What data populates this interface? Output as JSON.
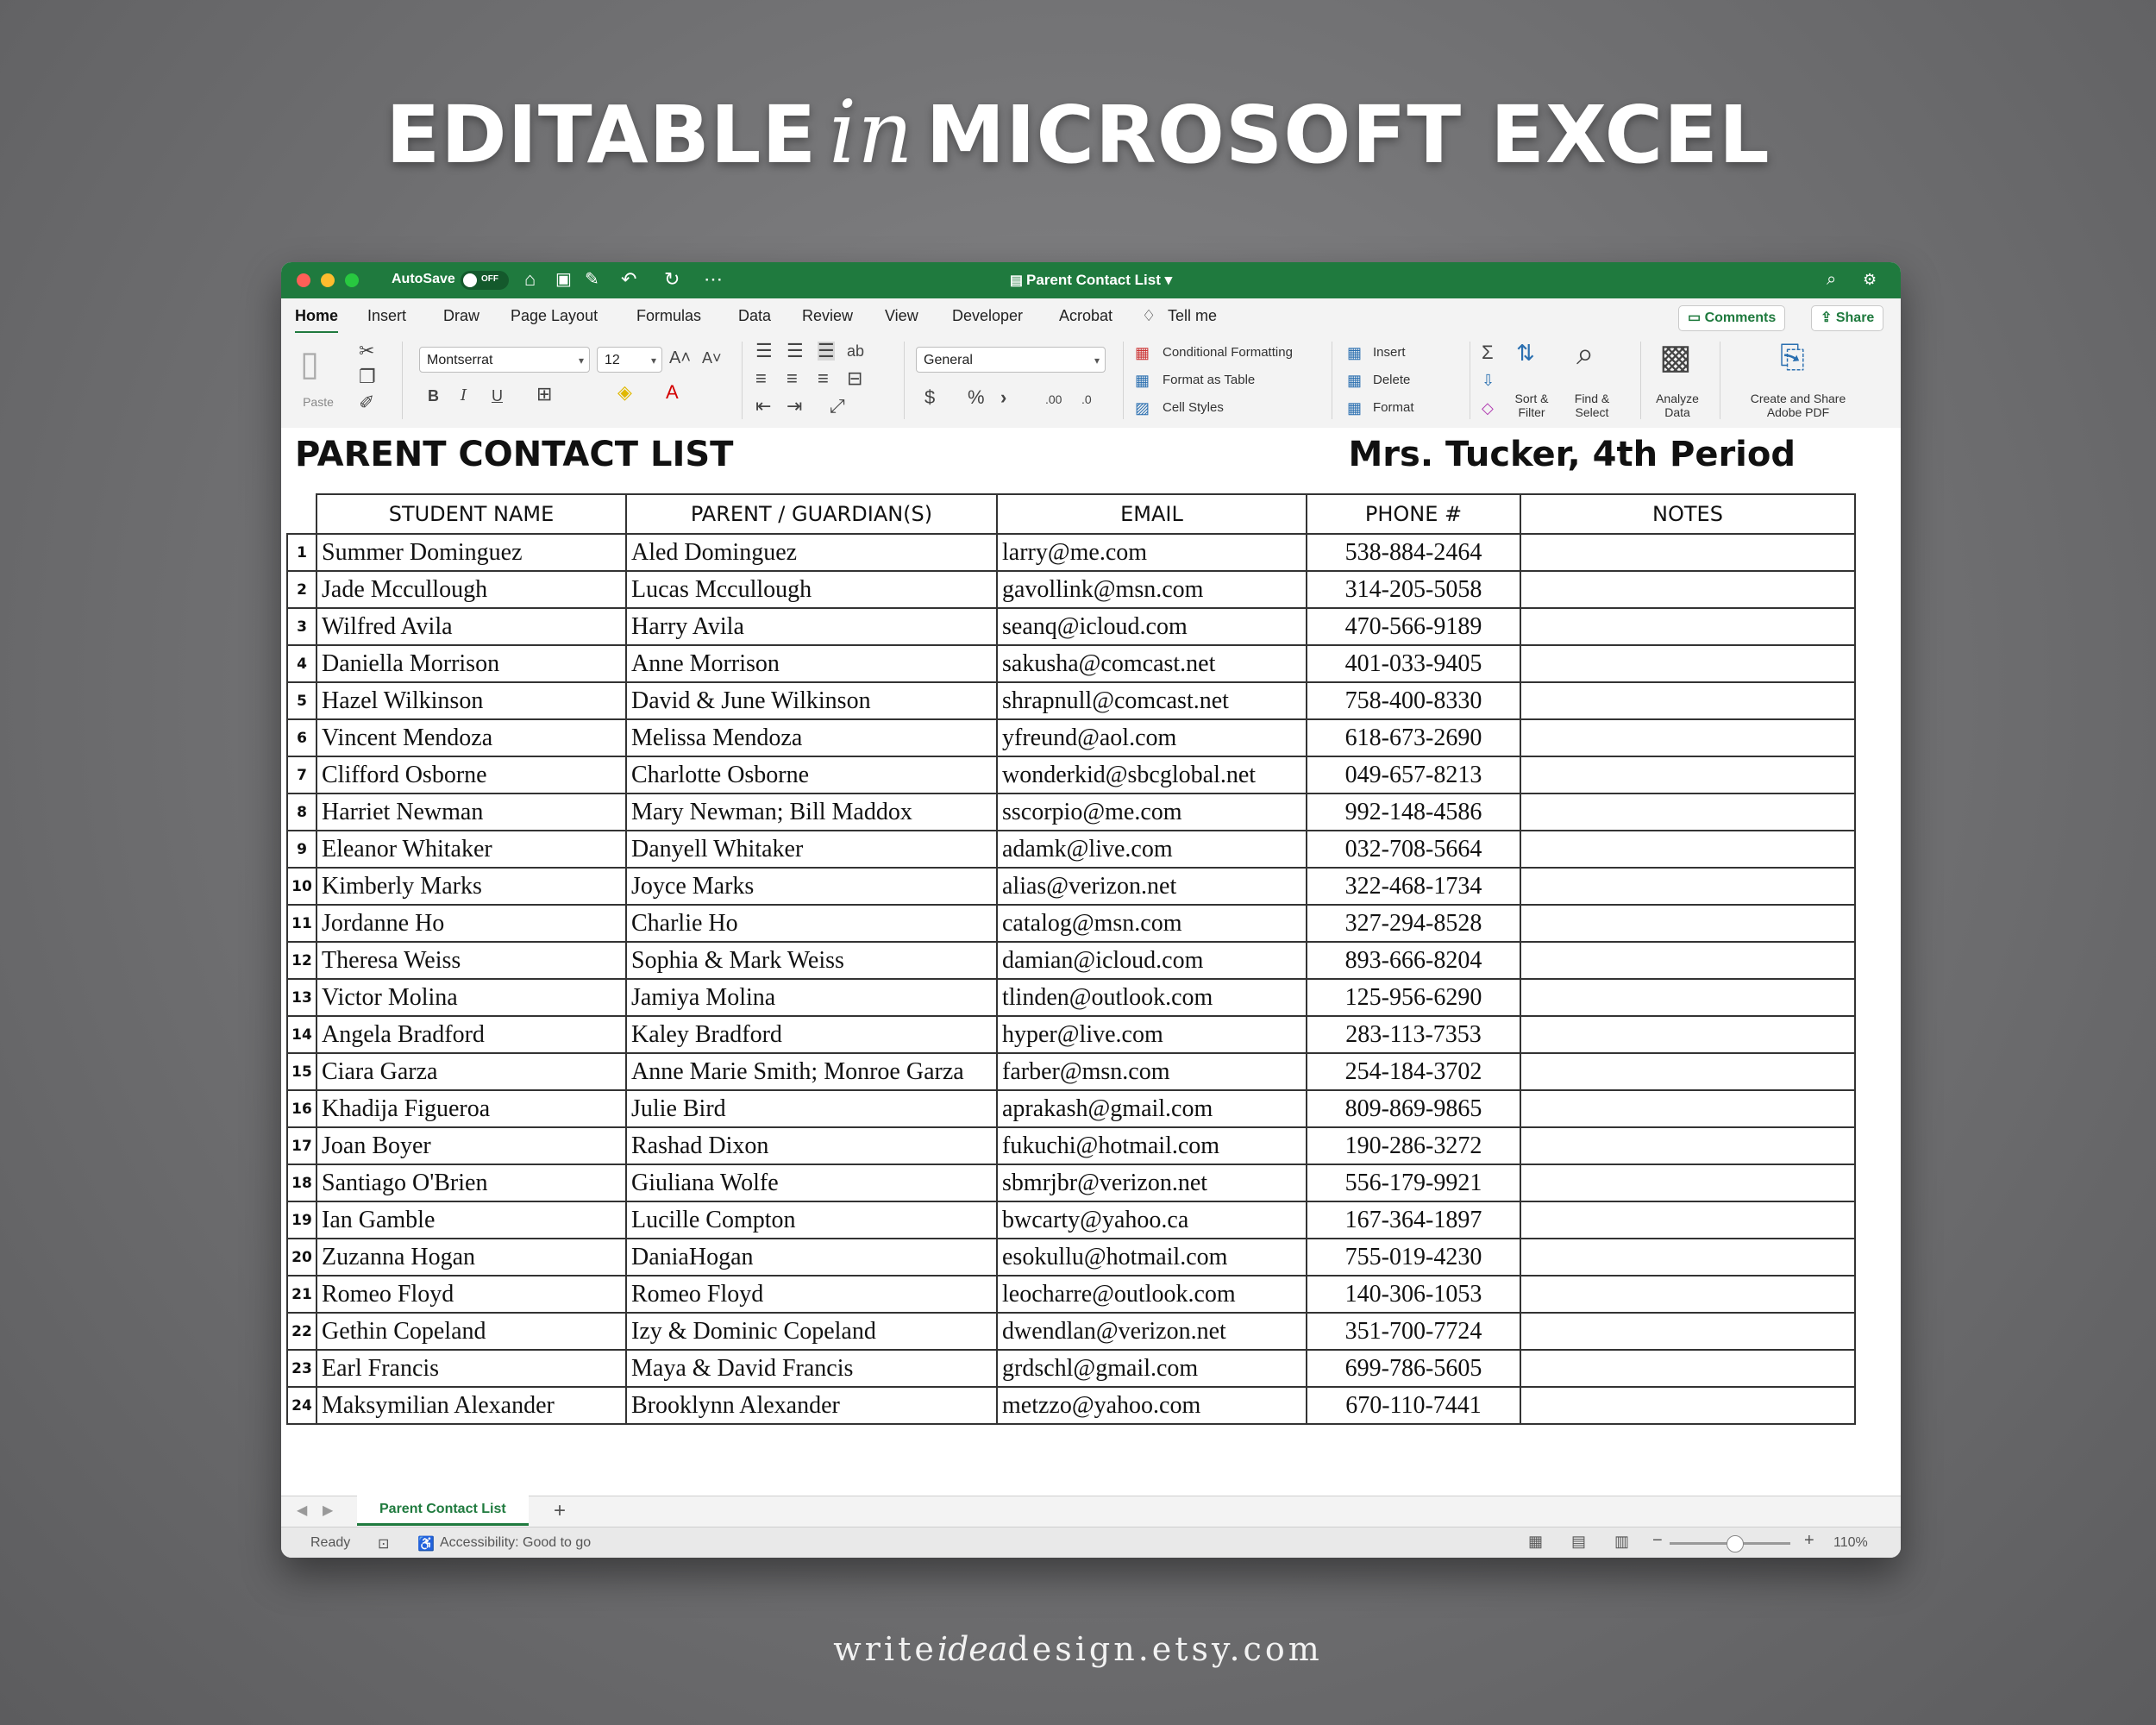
{
  "promo": {
    "headline_left": "EDITABLE",
    "headline_script": "in",
    "headline_right": "MICROSOFT EXCEL",
    "credit_a": "write",
    "credit_b": "idea",
    "credit_c": "design.etsy.com"
  },
  "titlebar": {
    "autosave_label": "AutoSave",
    "autosave_state": "OFF",
    "document_title": "Parent Contact List"
  },
  "ribbon_tabs": [
    "Home",
    "Insert",
    "Draw",
    "Page Layout",
    "Formulas",
    "Data",
    "Review",
    "View",
    "Developer",
    "Acrobat"
  ],
  "tell_me": "Tell me",
  "comments_label": "Comments",
  "share_label": "Share",
  "ribbon": {
    "paste_label": "Paste",
    "font_name": "Montserrat",
    "font_size": "12",
    "number_format": "General",
    "conditional_formatting": "Conditional Formatting",
    "format_as_table": "Format as Table",
    "cell_styles": "Cell Styles",
    "insert": "Insert",
    "delete": "Delete",
    "format": "Format",
    "sort_filter_1": "Sort &",
    "sort_filter_2": "Filter",
    "find_select_1": "Find &",
    "find_select_2": "Select",
    "analyze_1": "Analyze",
    "analyze_2": "Data",
    "pdf_1": "Create and Share",
    "pdf_2": "Adobe PDF"
  },
  "sheet": {
    "title": "PARENT CONTACT LIST",
    "subtitle": "Mrs. Tucker, 4th Period",
    "headers": [
      "STUDENT NAME",
      "PARENT / GUARDIAN(S)",
      "EMAIL",
      "PHONE #",
      "NOTES"
    ],
    "rows": [
      [
        "1",
        "Summer Dominguez",
        "Aled Dominguez",
        "larry@me.com",
        "538-884-2464",
        ""
      ],
      [
        "2",
        "Jade Mccullough",
        "Lucas Mccullough",
        "gavollink@msn.com",
        "314-205-5058",
        ""
      ],
      [
        "3",
        "Wilfred Avila",
        "Harry Avila",
        "seanq@icloud.com",
        "470-566-9189",
        ""
      ],
      [
        "4",
        "Daniella Morrison",
        "Anne Morrison",
        "sakusha@comcast.net",
        "401-033-9405",
        ""
      ],
      [
        "5",
        "Hazel Wilkinson",
        "David & June Wilkinson",
        "shrapnull@comcast.net",
        "758-400-8330",
        ""
      ],
      [
        "6",
        "Vincent Mendoza",
        "Melissa Mendoza",
        "yfreund@aol.com",
        "618-673-2690",
        ""
      ],
      [
        "7",
        "Clifford Osborne",
        "Charlotte Osborne",
        "wonderkid@sbcglobal.net",
        "049-657-8213",
        ""
      ],
      [
        "8",
        "Harriet Newman",
        "Mary Newman; Bill Maddox",
        "sscorpio@me.com",
        "992-148-4586",
        ""
      ],
      [
        "9",
        "Eleanor Whitaker",
        "Danyell Whitaker",
        "adamk@live.com",
        "032-708-5664",
        ""
      ],
      [
        "10",
        "Kimberly Marks",
        "Joyce Marks",
        "alias@verizon.net",
        "322-468-1734",
        ""
      ],
      [
        "11",
        "Jordanne Ho",
        "Charlie Ho",
        "catalog@msn.com",
        "327-294-8528",
        ""
      ],
      [
        "12",
        "Theresa Weiss",
        "Sophia & Mark Weiss",
        "damian@icloud.com",
        "893-666-8204",
        ""
      ],
      [
        "13",
        "Victor Molina",
        "Jamiya Molina",
        "tlinden@outlook.com",
        "125-956-6290",
        ""
      ],
      [
        "14",
        "Angela Bradford",
        "Kaley Bradford",
        "hyper@live.com",
        "283-113-7353",
        ""
      ],
      [
        "15",
        "Ciara Garza",
        "Anne Marie Smith; Monroe Garza",
        "farber@msn.com",
        "254-184-3702",
        ""
      ],
      [
        "16",
        "Khadija Figueroa",
        "Julie Bird",
        "aprakash@gmail.com",
        "809-869-9865",
        ""
      ],
      [
        "17",
        "Joan Boyer",
        "Rashad Dixon",
        "fukuchi@hotmail.com",
        "190-286-3272",
        ""
      ],
      [
        "18",
        "Santiago O'Brien",
        "Giuliana Wolfe",
        "sbmrjbr@verizon.net",
        "556-179-9921",
        ""
      ],
      [
        "19",
        "Ian Gamble",
        "Lucille Compton",
        "bwcarty@yahoo.ca",
        "167-364-1897",
        ""
      ],
      [
        "20",
        "Zuzanna Hogan",
        "DaniaHogan",
        "esokullu@hotmail.com",
        "755-019-4230",
        ""
      ],
      [
        "21",
        "Romeo Floyd",
        "Romeo Floyd",
        "leocharre@outlook.com",
        "140-306-1053",
        ""
      ],
      [
        "22",
        "Gethin Copeland",
        "Izy & Dominic Copeland",
        "dwendlan@verizon.net",
        "351-700-7724",
        ""
      ],
      [
        "23",
        "Earl Francis",
        "Maya & David Francis",
        "grdschl@gmail.com",
        "699-786-5605",
        ""
      ],
      [
        "24",
        "Maksymilian Alexander",
        "Brooklynn Alexander",
        "metzzo@yahoo.com",
        "670-110-7441",
        ""
      ]
    ]
  },
  "sheet_tab": "Parent Contact List",
  "status": {
    "ready": "Ready",
    "accessibility": "Accessibility: Good to go",
    "zoom": "110%"
  },
  "colors": {
    "excel_green": "#1f7a3e"
  }
}
